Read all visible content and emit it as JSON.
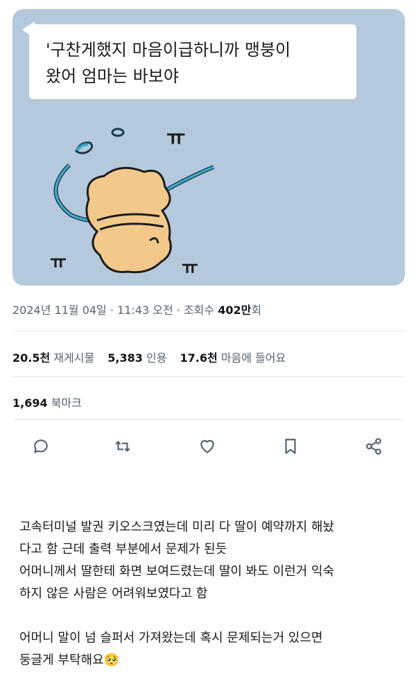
{
  "media": {
    "bubble_text": "'구찬게했지 마음이급하니까 맹붕이\n왔어  엄마는 바보야",
    "background_color": "#b5c9dc",
    "illustration_icon": "fallen-bear-crying-illustration",
    "tear_marks": [
      "ㅠ",
      "ㅠ",
      "ㅠ"
    ]
  },
  "meta": {
    "date": "2024년 11월 04일",
    "separator1": " · ",
    "time": "11:43 오전",
    "separator2": " · ",
    "views_label": "조회수 ",
    "views_value": "402만",
    "views_suffix": "회"
  },
  "stats": {
    "reposts_value": "20.5천",
    "reposts_label": "재게시물",
    "quotes_value": "5,383",
    "quotes_label": "인용",
    "likes_value": "17.6천",
    "likes_label": "마음에 들어요"
  },
  "bookmarks": {
    "value": "1,694",
    "label": "북마크"
  },
  "actions": {
    "icons": [
      "reply-icon",
      "repost-icon",
      "like-icon",
      "bookmark-icon",
      "share-icon"
    ],
    "icon_color": "#536471"
  },
  "post_body": "고속터미널 발권 키오스크였는데 미리 다 딸이 예약까지 해놨\n다고 함 근데 출력 부분에서 문제가 된듯\n어머니께서 딸한테 화면 보여드렸는데 딸이 봐도 이런거 익숙\n하지 않은 사람은 어려워보였다고 함\n\n어머니 말이 넘 슬퍼서 가져왔는데 혹시 문제되는거 있으면\n둥글게 부탁해요🥺"
}
